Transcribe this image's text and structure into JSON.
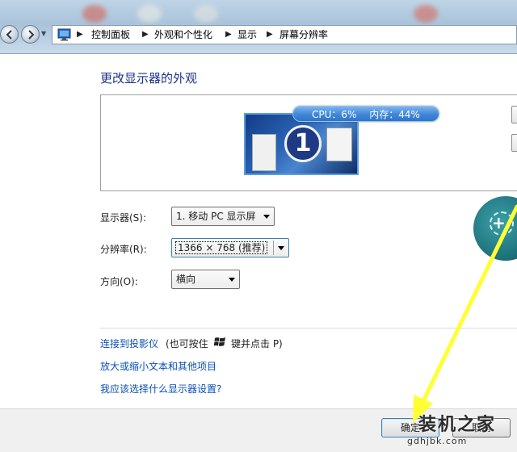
{
  "breadcrumb": {
    "items": [
      "控制面板",
      "外观和个性化",
      "显示",
      "屏幕分辨率"
    ]
  },
  "page": {
    "title": "更改显示器的外观"
  },
  "preview": {
    "monitor_number": "1",
    "cpu_label": "CPU：6%",
    "memory_label": "内存：44%"
  },
  "settings": {
    "display_label": "显示器(S):",
    "display_value": "1. 移动 PC 显示屏",
    "resolution_label": "分辨率(R):",
    "resolution_value": "1366 × 768 (推荐)",
    "orientation_label": "方向(O):",
    "orientation_value": "横向"
  },
  "links": {
    "projector": "连接到投影仪",
    "projector_note_a": "(也可按住",
    "projector_note_b": "键并点击 P)",
    "text_size": "放大或缩小文本和其他项目",
    "which_settings": "我应该选择什么显示器设置?"
  },
  "buttons": {
    "ok": "确定",
    "cancel": "取消"
  },
  "watermark": {
    "title": "装机之家",
    "url": "gdhjbk.com"
  },
  "colors": {
    "title": "#1e3287",
    "link": "#0b4fb4",
    "annotation_arrow": "#ffff33",
    "cpu_bar": "#3f86d8"
  },
  "icons": [
    "back-icon",
    "forward-icon",
    "control-panel-icon",
    "windows-logo-icon"
  ]
}
